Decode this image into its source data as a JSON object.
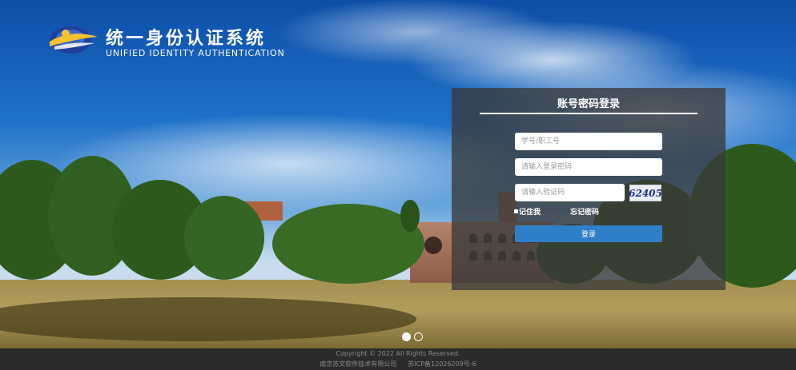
{
  "header": {
    "logo_icon": "university-emblem-icon",
    "title_cn": "统一身份认证系统",
    "title_en": "UNIFIED IDENTITY AUTHENTICATION"
  },
  "login": {
    "title": "账号密码登录",
    "username_placeholder": "学号/职工号",
    "password_placeholder": "请输入登录密码",
    "captcha_placeholder": "请输入验证码",
    "captcha_text": "62405",
    "remember_label": "记住我",
    "forgot_label": "忘记密码",
    "submit_label": "登录"
  },
  "carousel": {
    "slide_count": 2,
    "active_index": 0
  },
  "footer": {
    "copyright": "Copyright © 2022 All Rights Reserved.",
    "company": "南京苏文软件技术有限公司",
    "icp": "苏ICP备12026209号-6"
  },
  "colors": {
    "primary_button": "#2f7ec8",
    "panel_bg": "rgba(58,58,58,0.78)",
    "footer_bg": "#2b2b2b"
  }
}
